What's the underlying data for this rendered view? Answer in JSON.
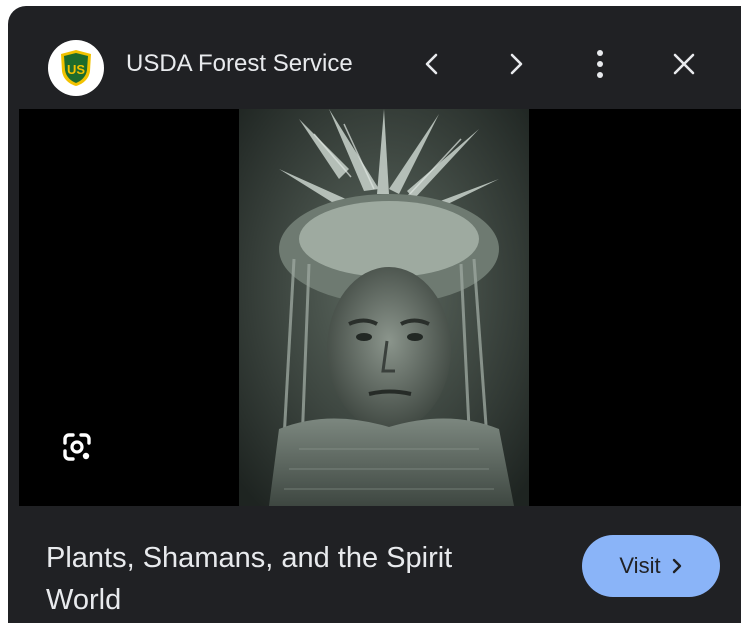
{
  "header": {
    "source_name": "USDA Forest Service",
    "logo_text": "US",
    "icons": {
      "prev": "chevron-left-icon",
      "next": "chevron-right-icon",
      "more": "more-vert-icon",
      "close": "close-icon"
    }
  },
  "media": {
    "lens_icon": "google-lens-icon"
  },
  "result": {
    "title": "Plants, Shamans, and the Spirit World",
    "visit_label": "Visit",
    "visit_icon": "chevron-right-icon"
  },
  "colors": {
    "panel_bg": "#202124",
    "text": "#e8eaed",
    "accent": "#8ab4f8",
    "logo_green": "#1e6b2c",
    "logo_yellow": "#f2c200"
  }
}
